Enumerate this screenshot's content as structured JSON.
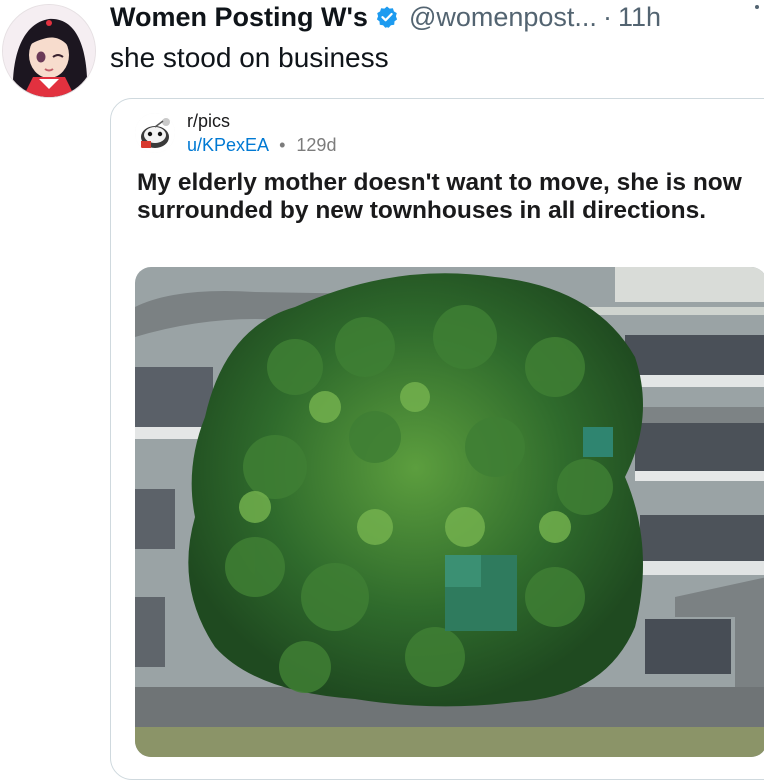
{
  "tweet": {
    "display_name": "Women Posting W's",
    "handle": "@womenpost...",
    "separator": "·",
    "time": "11h",
    "text": "she stood on business"
  },
  "quote": {
    "subreddit": "r/pics",
    "user": "u/KPexEA",
    "separator": "•",
    "age": "129d",
    "title": "My elderly mother doesn't want to move, she is now surrounded by new townhouses in all directions."
  },
  "icons": {
    "verified": "verified-badge-icon",
    "more": "more-options-icon"
  },
  "colors": {
    "verified": "#1d9bf0",
    "link": "#0079d3",
    "secondary": "#536471"
  }
}
